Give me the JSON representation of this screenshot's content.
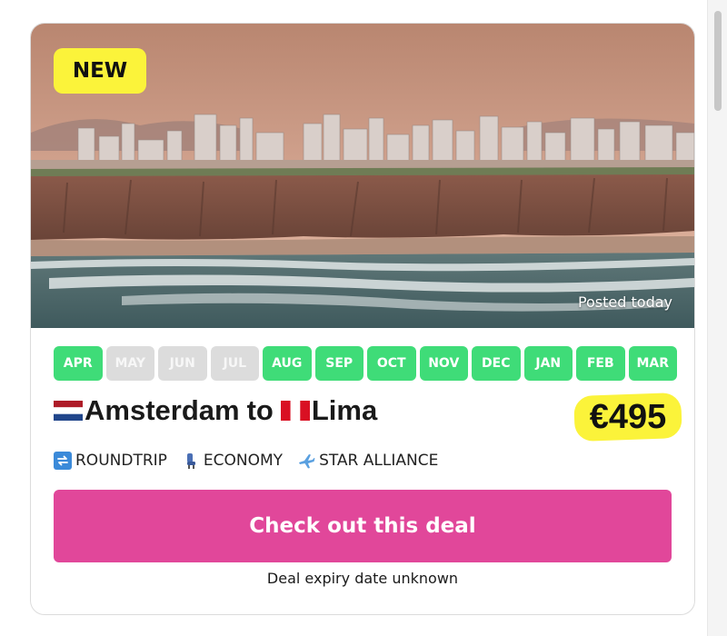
{
  "deal": {
    "badge": "NEW",
    "posted": "Posted today",
    "months": [
      {
        "label": "APR",
        "available": true
      },
      {
        "label": "MAY",
        "available": false
      },
      {
        "label": "JUN",
        "available": false
      },
      {
        "label": "JUL",
        "available": false
      },
      {
        "label": "AUG",
        "available": true
      },
      {
        "label": "SEP",
        "available": true
      },
      {
        "label": "OCT",
        "available": true
      },
      {
        "label": "NOV",
        "available": true
      },
      {
        "label": "DEC",
        "available": true
      },
      {
        "label": "JAN",
        "available": true
      },
      {
        "label": "FEB",
        "available": true
      },
      {
        "label": "MAR",
        "available": true
      }
    ],
    "origin": "Amsterdam",
    "to_word": "to",
    "destination": "Lima",
    "origin_flag": "netherlands-flag-icon",
    "destination_flag": "peru-flag-icon",
    "price": "€495",
    "features": [
      {
        "icon": "roundtrip-icon",
        "label": "ROUNDTRIP"
      },
      {
        "icon": "seat-icon",
        "label": "ECONOMY"
      },
      {
        "icon": "airplane-icon",
        "label": "STAR ALLIANCE"
      }
    ],
    "cta_label": "Check out this deal",
    "expiry": "Deal expiry date unknown"
  },
  "colors": {
    "badge": "#fbf33a",
    "month_on": "#3fdc78",
    "month_off": "#dcdcdc",
    "cta": "#e1479a",
    "price_highlight": "#fbf33a"
  }
}
